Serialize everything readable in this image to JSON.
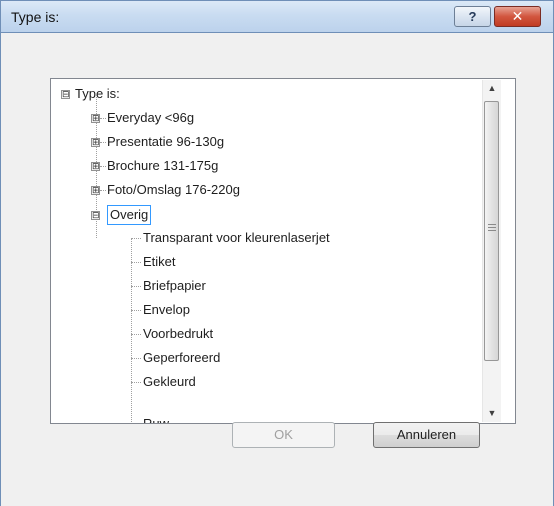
{
  "dialog": {
    "title": "Type is:",
    "help_glyph": "?",
    "close_glyph": "✕"
  },
  "tree": {
    "root": {
      "label": "Type is:",
      "expander": "⊟"
    },
    "categories": [
      {
        "label": "Everyday <96g",
        "expander": "⊞"
      },
      {
        "label": "Presentatie 96-130g",
        "expander": "⊞"
      },
      {
        "label": "Brochure 131-175g",
        "expander": "⊞"
      },
      {
        "label": "Foto/Omslag 176-220g",
        "expander": "⊞"
      }
    ],
    "expanded": {
      "label": "Overig",
      "expander": "⊟",
      "selected": true
    },
    "children": [
      "Transparant voor kleurenlaserjet",
      "Etiket",
      "Briefpapier",
      "Envelop",
      "Voorbedrukt",
      "Geperforeerd",
      "Gekleurd",
      "Ruw"
    ]
  },
  "scrollbar": {
    "up_glyph": "▲",
    "down_glyph": "▼",
    "thumb_icon": "grip-icon"
  },
  "buttons": {
    "ok_label": "OK",
    "ok_enabled": false,
    "cancel_label": "Annuleren"
  },
  "colors": {
    "selection_border": "#3399ff",
    "close_button": "#c03b22",
    "titlebar": "#c9dcf1"
  }
}
